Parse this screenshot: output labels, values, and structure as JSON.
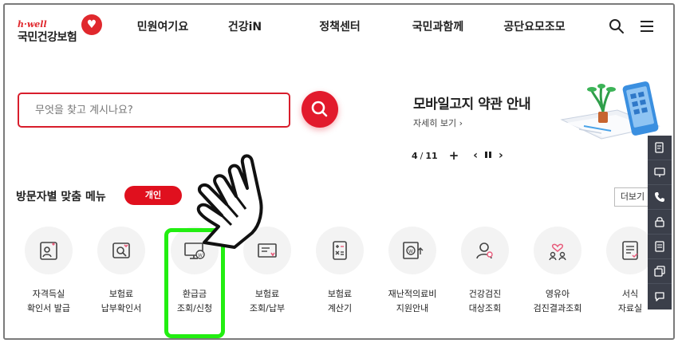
{
  "header": {
    "logo_brand": "h·well",
    "logo_name": "국민건강보험",
    "nav": [
      "민원여기요",
      "건강iN",
      "정책센터",
      "국민과함께",
      "공단요모조모"
    ],
    "icons": [
      "search-icon",
      "hamburger-menu-icon"
    ]
  },
  "search": {
    "placeholder": "무엇을 찾고 계시나요?",
    "button_icon": "search-icon"
  },
  "banner": {
    "title": "모바일고지 약관 안내",
    "link": "자세히 보기",
    "page_current": "4",
    "page_total": "11"
  },
  "custom_menu": {
    "title": "방문자별 맞춤 메뉴",
    "tab_active": "개인",
    "more_label": "더보기"
  },
  "menu_items": [
    {
      "label": "자격득실\n확인서 발급",
      "icon": "person-certificate-icon"
    },
    {
      "label": "보험료\n납부확인서",
      "icon": "document-search-icon"
    },
    {
      "label": "환급금\n조회/신청",
      "icon": "monitor-won-icon"
    },
    {
      "label": "보험료\n조회/납부",
      "icon": "bill-icon"
    },
    {
      "label": "보험료\n계산기",
      "icon": "calculator-icon"
    },
    {
      "label": "재난적의료비\n지원안내",
      "icon": "won-support-icon"
    },
    {
      "label": "건강검진\n대상조회",
      "icon": "person-search-icon"
    },
    {
      "label": "영유아\n검진결과조회",
      "icon": "child-heart-icon"
    },
    {
      "label": "서식\n자료실",
      "icon": "form-document-icon"
    }
  ],
  "quick_bar": [
    "phone-doc-icon",
    "monitor-icon",
    "call-icon",
    "lock-icon",
    "document-icon",
    "copy-icon",
    "chat-icon"
  ],
  "colors": {
    "accent": "#e21a2c",
    "highlight": "#22ee11",
    "quickbar": "#3b3f4a"
  }
}
